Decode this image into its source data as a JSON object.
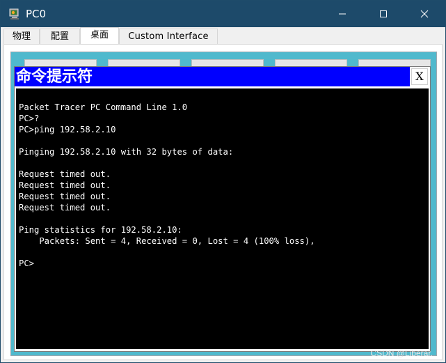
{
  "window": {
    "title": "PC0",
    "icon": "pc-app-icon",
    "controls": {
      "minimize": "minimize-icon",
      "maximize": "maximize-icon",
      "close": "close-icon"
    },
    "colors": {
      "titlebar": "#1d4a6a",
      "desktop": "#50b9cd",
      "cmd_titlebar": "#0000ff",
      "terminal_bg": "#000000"
    }
  },
  "tabs": [
    {
      "label": "物理",
      "active": false
    },
    {
      "label": "配置",
      "active": false
    },
    {
      "label": "桌面",
      "active": true
    },
    {
      "label": "Custom Interface",
      "active": false
    }
  ],
  "cmd": {
    "title": "命令提示符",
    "close_label": "X",
    "lines": [
      "Packet Tracer PC Command Line 1.0",
      "PC>?",
      "PC>ping 192.58.2.10",
      "",
      "Pinging 192.58.2.10 with 32 bytes of data:",
      "",
      "Request timed out.",
      "Request timed out.",
      "Request timed out.",
      "Request timed out.",
      "",
      "Ping statistics for 192.58.2.10:",
      "    Packets: Sent = 4, Received = 0, Lost = 4 (100% loss),",
      "",
      "PC>"
    ]
  },
  "watermark": "CSDN @Liberar."
}
